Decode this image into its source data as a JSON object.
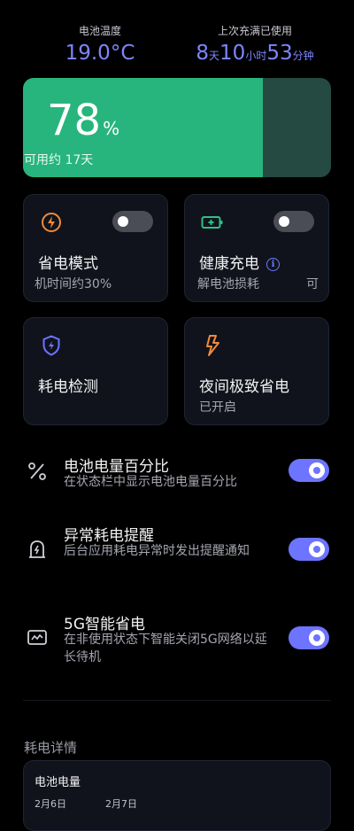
{
  "stats": {
    "temperature": {
      "label": "电池温度",
      "value": "19.0°C"
    },
    "since_full": {
      "label": "上次充满已使用",
      "days": "8",
      "days_unit": "天",
      "hours": "10",
      "hours_unit": "小时",
      "minutes": "53",
      "minutes_unit": "分钟"
    }
  },
  "battery": {
    "level_percent": 78,
    "percent_text": "78",
    "percent_sign": "%",
    "remaining_text": "可用约 17天",
    "colors": {
      "fill": "#27b57d",
      "empty": "#244a42"
    }
  },
  "cards": {
    "power_saving": {
      "title": "省电模式",
      "subtitle": "机时间约30%",
      "toggle_on": false,
      "icon": "lightning-circle-icon"
    },
    "healthy_charging": {
      "title": "健康充电",
      "subtitle": "解电池损耗",
      "subtitle_extra": "可",
      "toggle_on": false,
      "icon": "battery-plus-icon"
    },
    "power_detection": {
      "title": "耗电检测",
      "icon": "shield-lightning-icon"
    },
    "night_saving": {
      "title": "夜间极致省电",
      "subtitle": "已开启",
      "icon": "lightning-bolt-icon"
    }
  },
  "settings": [
    {
      "title": "电池电量百分比",
      "description": "在状态栏中显示电池电量百分比",
      "enabled": true,
      "icon": "percent-icon"
    },
    {
      "title": "异常耗电提醒",
      "description": "后台应用耗电异常时发出提醒通知",
      "enabled": true,
      "icon": "tombstone-lightning-icon"
    },
    {
      "title": "5G智能省电",
      "description": "在非使用状态下智能关闭5G网络以延长待机",
      "enabled": true,
      "icon": "monitor-wave-icon"
    }
  ],
  "details": {
    "section_title": "耗电详情",
    "card_title": "电池电量",
    "dates": [
      "2月6日",
      "2月7日"
    ]
  },
  "colors": {
    "accent": "#6d74ff",
    "background": "#000000",
    "card": "#10131c"
  }
}
